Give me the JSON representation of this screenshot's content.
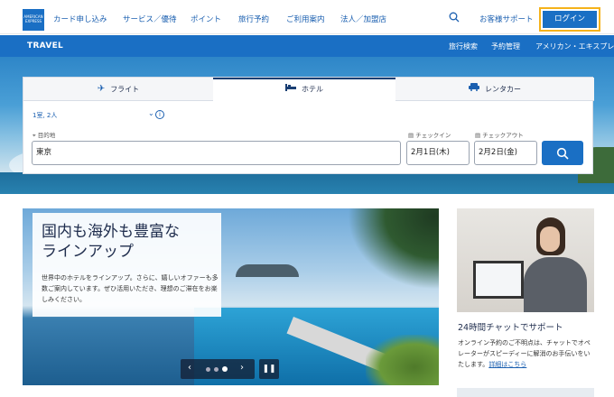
{
  "brand": {
    "logo_text": "AMERICAN EXPRESS"
  },
  "topnav": {
    "items": [
      "カード申し込み",
      "サービス／優待",
      "ポイント",
      "旅行予約",
      "ご利用案内",
      "法人／加盟店"
    ],
    "support": "お客様サポート",
    "login": "ログイン",
    "search_icon": "search-icon"
  },
  "travelbar": {
    "title": "TRAVEL",
    "links": [
      "旅行検索",
      "予約管理",
      "アメリカン・エキスプレ"
    ]
  },
  "search": {
    "tabs": [
      {
        "label": "フライト",
        "icon": "plane-icon",
        "active": false
      },
      {
        "label": "ホテル",
        "icon": "bed-icon",
        "active": true
      },
      {
        "label": "レンタカー",
        "icon": "car-icon",
        "active": false
      }
    ],
    "rooms": "1室, 2人",
    "destination_label": "目的地",
    "destination_value": "東京",
    "checkin_label": "チェックイン",
    "checkin_value": "2月1日(木)",
    "checkout_label": "チェックアウト",
    "checkout_value": "2月2日(金)"
  },
  "promo": {
    "title_line1": "国内も海外も豊富な",
    "title_line2": "ラインアップ",
    "text": "世界中のホテルをラインアップ。さらに、嬉しいオファーも多数ご案内しています。ぜひ活用いただき、理想のご滞在をお楽しみください。",
    "carousel_active": 3
  },
  "support_card": {
    "title": "24時間チャットでサポート",
    "text": "オンライン予約のご不明点は、チャットでオペレーターがスピーディーに解消のお手伝いをいたします。",
    "link": "詳細はこちら"
  },
  "colors": {
    "accent": "#1a6fc4",
    "highlight_border": "#f5b21a"
  }
}
